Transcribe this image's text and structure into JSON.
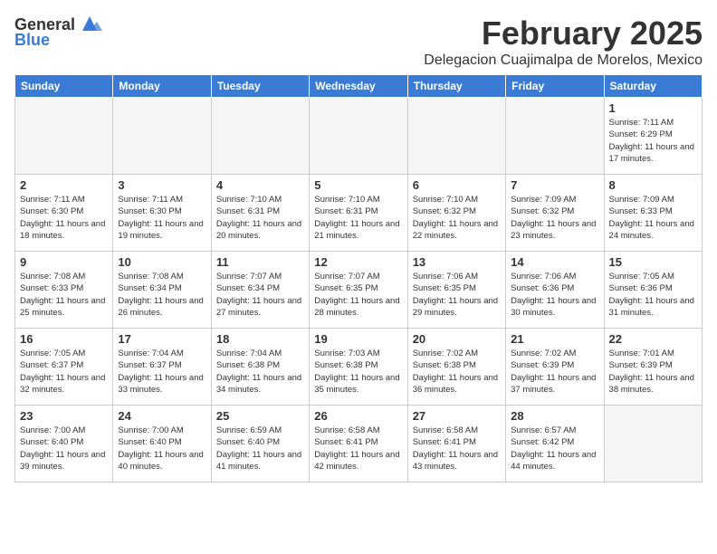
{
  "header": {
    "logo_general": "General",
    "logo_blue": "Blue",
    "title": "February 2025",
    "subtitle": "Delegacion Cuajimalpa de Morelos, Mexico"
  },
  "weekdays": [
    "Sunday",
    "Monday",
    "Tuesday",
    "Wednesday",
    "Thursday",
    "Friday",
    "Saturday"
  ],
  "weeks": [
    [
      {
        "day": "",
        "info": ""
      },
      {
        "day": "",
        "info": ""
      },
      {
        "day": "",
        "info": ""
      },
      {
        "day": "",
        "info": ""
      },
      {
        "day": "",
        "info": ""
      },
      {
        "day": "",
        "info": ""
      },
      {
        "day": "1",
        "info": "Sunrise: 7:11 AM\nSunset: 6:29 PM\nDaylight: 11 hours and 17 minutes."
      }
    ],
    [
      {
        "day": "2",
        "info": "Sunrise: 7:11 AM\nSunset: 6:30 PM\nDaylight: 11 hours and 18 minutes."
      },
      {
        "day": "3",
        "info": "Sunrise: 7:11 AM\nSunset: 6:30 PM\nDaylight: 11 hours and 19 minutes."
      },
      {
        "day": "4",
        "info": "Sunrise: 7:10 AM\nSunset: 6:31 PM\nDaylight: 11 hours and 20 minutes."
      },
      {
        "day": "5",
        "info": "Sunrise: 7:10 AM\nSunset: 6:31 PM\nDaylight: 11 hours and 21 minutes."
      },
      {
        "day": "6",
        "info": "Sunrise: 7:10 AM\nSunset: 6:32 PM\nDaylight: 11 hours and 22 minutes."
      },
      {
        "day": "7",
        "info": "Sunrise: 7:09 AM\nSunset: 6:32 PM\nDaylight: 11 hours and 23 minutes."
      },
      {
        "day": "8",
        "info": "Sunrise: 7:09 AM\nSunset: 6:33 PM\nDaylight: 11 hours and 24 minutes."
      }
    ],
    [
      {
        "day": "9",
        "info": "Sunrise: 7:08 AM\nSunset: 6:33 PM\nDaylight: 11 hours and 25 minutes."
      },
      {
        "day": "10",
        "info": "Sunrise: 7:08 AM\nSunset: 6:34 PM\nDaylight: 11 hours and 26 minutes."
      },
      {
        "day": "11",
        "info": "Sunrise: 7:07 AM\nSunset: 6:34 PM\nDaylight: 11 hours and 27 minutes."
      },
      {
        "day": "12",
        "info": "Sunrise: 7:07 AM\nSunset: 6:35 PM\nDaylight: 11 hours and 28 minutes."
      },
      {
        "day": "13",
        "info": "Sunrise: 7:06 AM\nSunset: 6:35 PM\nDaylight: 11 hours and 29 minutes."
      },
      {
        "day": "14",
        "info": "Sunrise: 7:06 AM\nSunset: 6:36 PM\nDaylight: 11 hours and 30 minutes."
      },
      {
        "day": "15",
        "info": "Sunrise: 7:05 AM\nSunset: 6:36 PM\nDaylight: 11 hours and 31 minutes."
      }
    ],
    [
      {
        "day": "16",
        "info": "Sunrise: 7:05 AM\nSunset: 6:37 PM\nDaylight: 11 hours and 32 minutes."
      },
      {
        "day": "17",
        "info": "Sunrise: 7:04 AM\nSunset: 6:37 PM\nDaylight: 11 hours and 33 minutes."
      },
      {
        "day": "18",
        "info": "Sunrise: 7:04 AM\nSunset: 6:38 PM\nDaylight: 11 hours and 34 minutes."
      },
      {
        "day": "19",
        "info": "Sunrise: 7:03 AM\nSunset: 6:38 PM\nDaylight: 11 hours and 35 minutes."
      },
      {
        "day": "20",
        "info": "Sunrise: 7:02 AM\nSunset: 6:38 PM\nDaylight: 11 hours and 36 minutes."
      },
      {
        "day": "21",
        "info": "Sunrise: 7:02 AM\nSunset: 6:39 PM\nDaylight: 11 hours and 37 minutes."
      },
      {
        "day": "22",
        "info": "Sunrise: 7:01 AM\nSunset: 6:39 PM\nDaylight: 11 hours and 38 minutes."
      }
    ],
    [
      {
        "day": "23",
        "info": "Sunrise: 7:00 AM\nSunset: 6:40 PM\nDaylight: 11 hours and 39 minutes."
      },
      {
        "day": "24",
        "info": "Sunrise: 7:00 AM\nSunset: 6:40 PM\nDaylight: 11 hours and 40 minutes."
      },
      {
        "day": "25",
        "info": "Sunrise: 6:59 AM\nSunset: 6:40 PM\nDaylight: 11 hours and 41 minutes."
      },
      {
        "day": "26",
        "info": "Sunrise: 6:58 AM\nSunset: 6:41 PM\nDaylight: 11 hours and 42 minutes."
      },
      {
        "day": "27",
        "info": "Sunrise: 6:58 AM\nSunset: 6:41 PM\nDaylight: 11 hours and 43 minutes."
      },
      {
        "day": "28",
        "info": "Sunrise: 6:57 AM\nSunset: 6:42 PM\nDaylight: 11 hours and 44 minutes."
      },
      {
        "day": "",
        "info": ""
      }
    ]
  ]
}
